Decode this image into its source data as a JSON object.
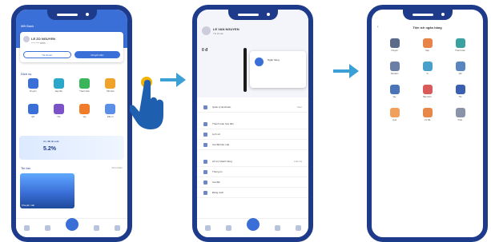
{
  "phone1": {
    "header_title": "MB Bank",
    "account_name": "LE ZO NGUYEN",
    "account_sub": "**** **** 8888",
    "btn_left": "Tài khoản",
    "btn_right": "Chuyển tiền",
    "section_title": "Dịch vụ",
    "tiles": [
      "Chuyển",
      "Nạp tiền",
      "Thanh toán",
      "Tiết kiệm",
      "QR",
      "Thẻ",
      "Vay",
      "Đầu tư"
    ],
    "banner_text": "Ưu đãi lãi suất",
    "banner_value": "5.2%",
    "news_title": "Tin tức",
    "news_more": "Xem thêm",
    "photo_caption": "Khuyến mãi"
  },
  "phone2": {
    "name": "LE VAN NGUYEN",
    "sub": "Tài khoản",
    "balance": "0 đ",
    "popup_text": "Ngân hàng",
    "menu": [
      {
        "label": "Quản lý tài khoản",
        "right": "Xem"
      },
      {
        "label": "Thanh toán hóa đơn",
        "right": ""
      },
      {
        "label": "Lịch sử",
        "right": ""
      },
      {
        "label": "Cài đặt bảo mật",
        "right": ""
      },
      {
        "label": "Hỗ trợ khách hàng",
        "right": "Liên hệ"
      },
      {
        "label": "Thông tin",
        "right": ""
      },
      {
        "label": "Cài đặt",
        "right": ""
      },
      {
        "label": "Đăng xuất",
        "right": ""
      }
    ]
  },
  "phone3": {
    "title": "Tiện ích ngân hàng",
    "tiles": [
      "Chuyển",
      "Nạp",
      "Thanh toán",
      "Tiết kiệm",
      "Ví",
      "QR",
      "Vay",
      "Bảo hiểm",
      "Thẻ",
      "Quà",
      "Ưu đãi",
      "Khác"
    ]
  },
  "colors": {
    "primary": "#1e3a8a",
    "accent": "#3b6fd8",
    "tap": "#f5b301",
    "arrow": "#3aa0d6"
  }
}
